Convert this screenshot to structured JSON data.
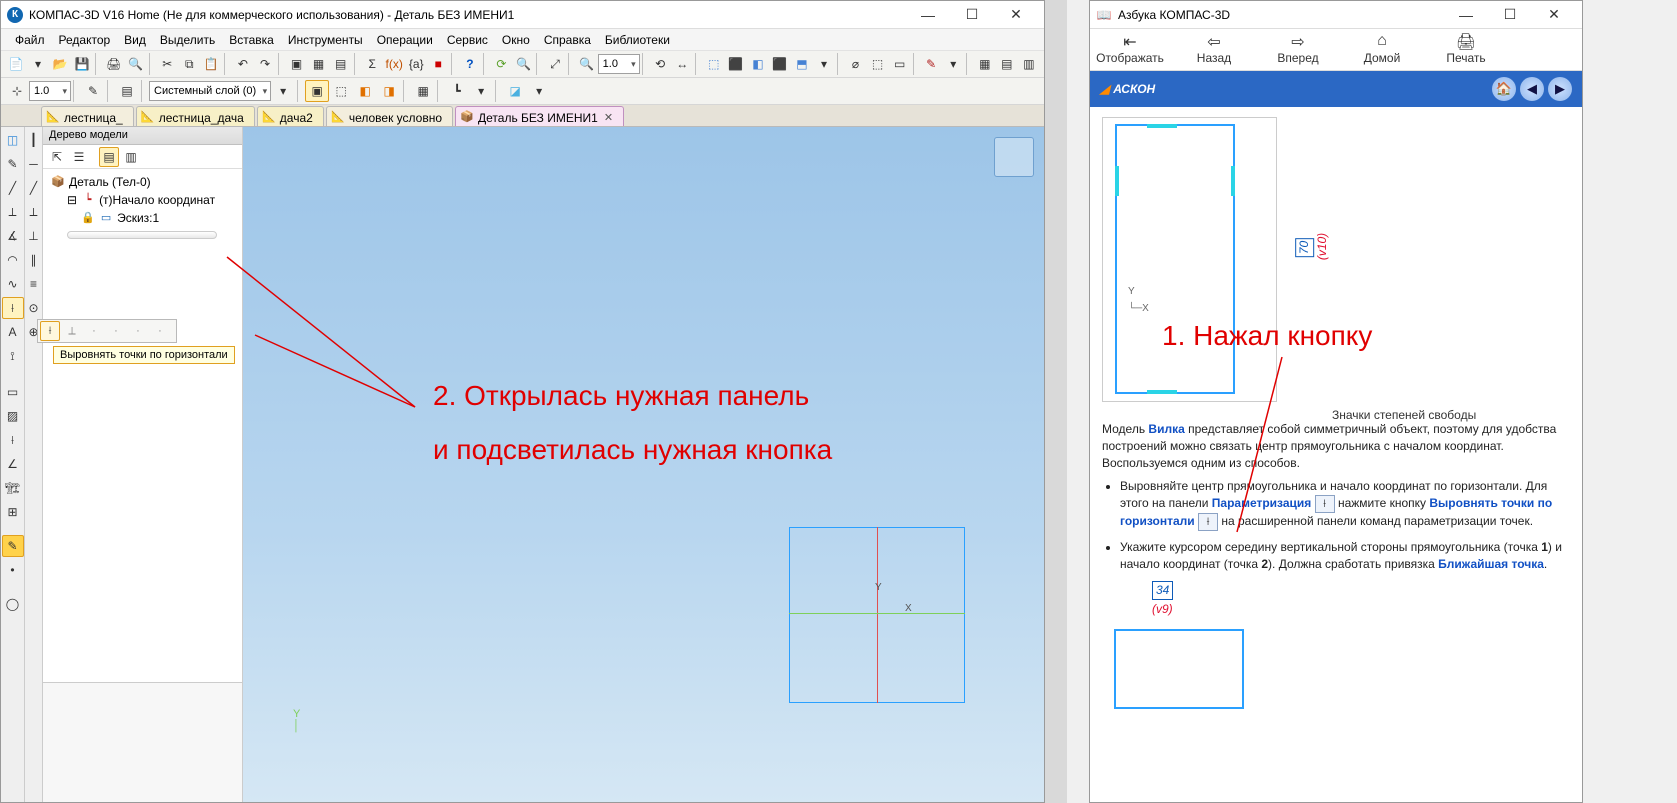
{
  "app": {
    "title": "КОМПАС-3D V16 Home  (Не для коммерческого использования) - Деталь БЕЗ ИМЕНИ1",
    "menus": [
      "Файл",
      "Редактор",
      "Вид",
      "Выделить",
      "Вставка",
      "Инструменты",
      "Операции",
      "Сервис",
      "Окно",
      "Справка",
      "Библиотеки"
    ],
    "zoom1": "1.0",
    "zoom2": "1.0",
    "layercombo": "Системный слой (0)",
    "tabs": [
      {
        "label": "лестница_",
        "icon": "📐",
        "active": false
      },
      {
        "label": "лестница_дача",
        "icon": "📐",
        "active": false
      },
      {
        "label": "дача2",
        "icon": "📐",
        "active": false
      },
      {
        "label": "человек условно",
        "icon": "📐",
        "active": false
      },
      {
        "label": "Деталь БЕЗ ИМЕНИ1",
        "icon": "📦",
        "active": true
      }
    ],
    "tree": {
      "title": "Дерево модели",
      "root": "Деталь (Тел-0)",
      "origin": "(т)Начало координат",
      "sketch": "Эскиз:1"
    },
    "tooltip": "Выровнять точки по горизонтали",
    "annot1": "2. Открылась нужная панель",
    "annot2": "и подсветилась нужная кнопка",
    "axisX": "X",
    "axisY": "Y"
  },
  "help": {
    "title": "Азбука КОМПАС-3D",
    "nav": [
      {
        "label": "Отображать",
        "name": "show"
      },
      {
        "label": "Назад",
        "name": "back"
      },
      {
        "label": "Вперед",
        "name": "forward"
      },
      {
        "label": "Домой",
        "name": "home"
      },
      {
        "label": "Печать",
        "name": "print"
      }
    ],
    "brand": "АСКОН",
    "figcaption": "Значки степеней свободы",
    "dim70": "70",
    "dimv10": "(v10)",
    "dim34": "34",
    "dimv9": "(v9)",
    "para_intro": "Модель ",
    "para_link": "Вилка",
    "para_rest": " представляет собой симметричный объект, поэтому для удобства построений можно связать центр прямоугольника с началом координат. Воспользуемся одним из способов.",
    "li1_a": "Выровняйте центр прямоугольника и начало координат по горизонтали. Для этого на панели ",
    "li1_link1": "Параметризация",
    "li1_b": " нажмите кнопку ",
    "li1_link2": "Выровнять точки по горизонтали",
    "li1_c": " на расширенной панели команд параметризации точек.",
    "li2_a": "Укажите курсором середину вертикальной стороны прямоугольника (точка ",
    "li2_pt1": "1",
    "li2_b": ") и начало координат (точка ",
    "li2_pt2": "2",
    "li2_c": "). Должна сработать привязка ",
    "li2_link": "Ближайшая точка",
    "li2_d": ".",
    "annot": "1. Нажал кнопку"
  }
}
